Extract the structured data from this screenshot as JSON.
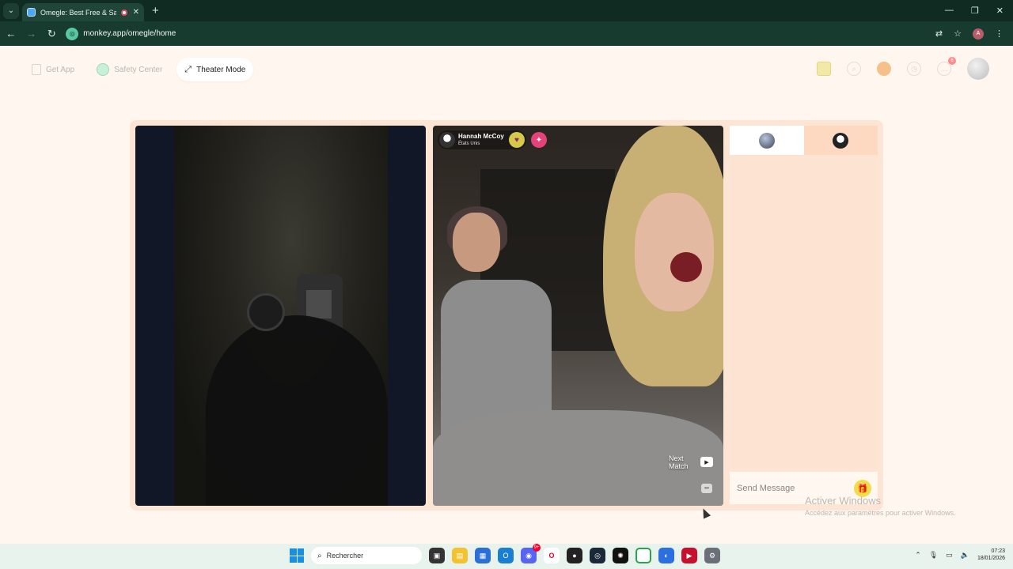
{
  "browser": {
    "tab_title": "Omegle: Best Free & Safe V",
    "url": "monkey.app/omegle/home",
    "profile_initial": "A"
  },
  "nav": {
    "get_app": "Get App",
    "safety_center": "Safety Center",
    "theater_mode": "Theater Mode"
  },
  "header": {
    "notification_count": "6"
  },
  "peer": {
    "name": "Hannah McCoy",
    "country": "États Unis"
  },
  "controls": {
    "next_match_line1": "Next",
    "next_match_line2": "Match"
  },
  "chat": {
    "placeholder": "Send Message"
  },
  "watermark": {
    "title": "Activer Windows",
    "subtitle": "Accédez aux paramètres pour activer Windows."
  },
  "taskbar": {
    "search_label": "Rechercher",
    "time": "07:23",
    "date": "18/01/2026",
    "discord_badge": "9+"
  },
  "colors": {
    "page_bg": "#fff7ef",
    "stage_bg": "#fde5d6",
    "chrome_dark": "#0f2b22",
    "gift": "#f3dc49"
  }
}
